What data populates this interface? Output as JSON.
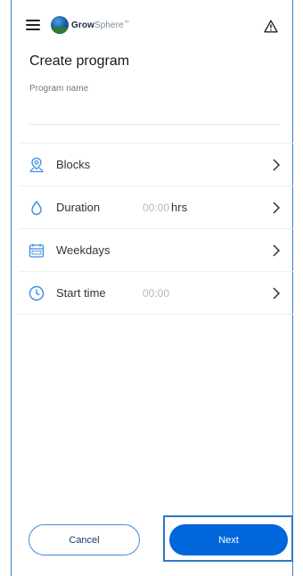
{
  "header": {
    "logo_grow": "Grow",
    "logo_sphere": "Sphere",
    "logo_tm": "™"
  },
  "page": {
    "title": "Create program",
    "program_name_label": "Program name",
    "program_name_value": ""
  },
  "settings": [
    {
      "label": "Blocks",
      "value": "",
      "unit": "",
      "icon": "location-pin-icon"
    },
    {
      "label": "Duration",
      "value": "00:00",
      "unit": "hrs",
      "icon": "water-drop-icon"
    },
    {
      "label": "Weekdays",
      "value": "",
      "unit": "",
      "icon": "calendar-icon"
    },
    {
      "label": "Start time",
      "value": "00:00",
      "unit": "",
      "icon": "clock-icon"
    }
  ],
  "buttons": {
    "cancel": "Cancel",
    "next": "Next"
  },
  "colors": {
    "accent": "#0066dc",
    "icon_blue": "#3b8de0",
    "frame": "#3d7fc1"
  }
}
